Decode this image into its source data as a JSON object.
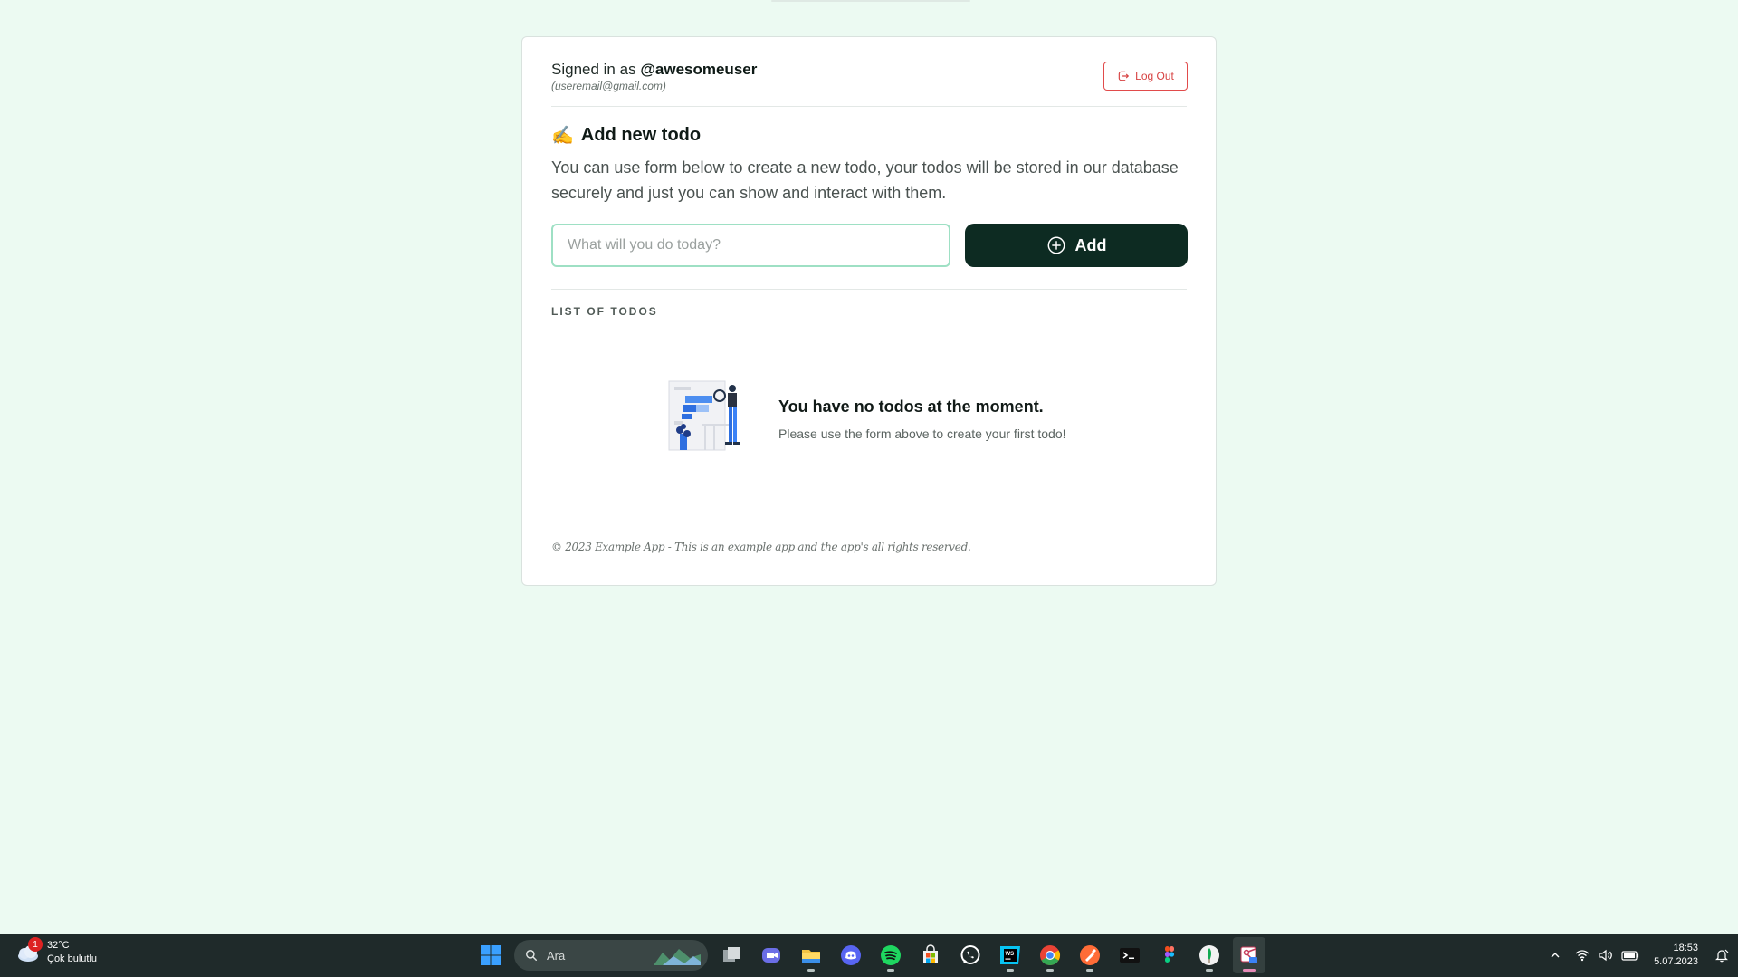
{
  "card": {
    "signed_prefix": "Signed in as",
    "username": "@awesomeuser",
    "email": "(useremail@gmail.com)",
    "logout_label": "Log Out",
    "heading_emoji": "✍️",
    "heading": "Add new todo",
    "description": "You can use form below to create a new todo, your todos will be stored in our database securely and just you can show and interact with them.",
    "input_placeholder": "What will you do today?",
    "input_value": "",
    "add_label": "Add",
    "list_label": "LIST OF TODOS",
    "empty_title": "You have no todos at the moment.",
    "empty_subtitle": "Please use the form above to create your first todo!",
    "footer": "© 2023 Example App - This is an example app and the app's all rights reserved."
  },
  "taskbar": {
    "weather": {
      "badge": "1",
      "temperature": "32°C",
      "condition": "Çok bulutlu"
    },
    "search_placeholder": "Ara",
    "apps": [
      {
        "name": "start-icon"
      },
      {
        "name": "task-view-icon"
      },
      {
        "name": "teams-icon"
      },
      {
        "name": "file-explorer-icon"
      },
      {
        "name": "discord-icon"
      },
      {
        "name": "spotify-icon"
      },
      {
        "name": "store-icon"
      },
      {
        "name": "whatsapp-icon"
      },
      {
        "name": "webstorm-icon"
      },
      {
        "name": "chrome-icon"
      },
      {
        "name": "postman-icon"
      },
      {
        "name": "terminal-icon"
      },
      {
        "name": "figma-icon"
      },
      {
        "name": "mongodb-compass-icon"
      },
      {
        "name": "snipping-tool-icon"
      }
    ],
    "clock": {
      "time": "18:53",
      "date": "5.07.2023"
    }
  },
  "colors": {
    "background": "#ecfaf2",
    "primary_button": "#0d2b22",
    "logout_red": "#e14b4b",
    "input_border": "#9ee0c4"
  }
}
